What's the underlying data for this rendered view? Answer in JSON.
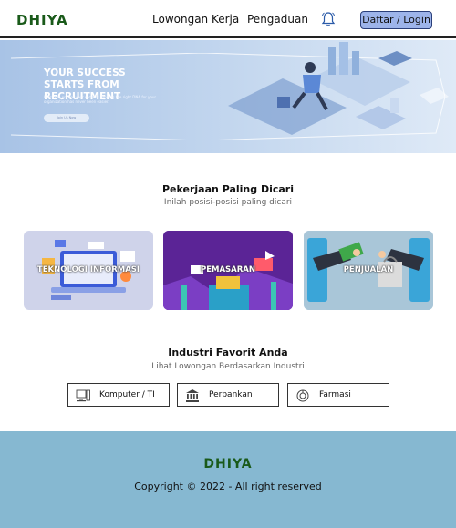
{
  "header": {
    "logo": "DHIYA",
    "nav": [
      "Lowongan Kerja",
      "Pengaduan"
    ],
    "login_label": "Daftar / Login",
    "bell_icon": "bell-icon"
  },
  "hero": {
    "title_line1": "YOUR SUCCESS",
    "title_line2": "STARTS FROM RECRUITMENT",
    "description": "Kerz.com ensure your success. Finding the right DNA for your organization has never been easier.",
    "button_label": "Join Us Now"
  },
  "jobs_section": {
    "title": "Pekerjaan Paling Dicari",
    "subtitle": "Inilah posisi-posisi paling dicari",
    "cards": [
      {
        "label": "TEKNOLOGI INFORMASI"
      },
      {
        "label": "PEMASARAN"
      },
      {
        "label": "PENJUALAN"
      }
    ]
  },
  "industry_section": {
    "title": "Industri Favorit Anda",
    "subtitle": "Lihat Lowongan Berdasarkan Industri",
    "items": [
      {
        "label": "Komputer / TI",
        "icon": "computer-icon"
      },
      {
        "label": "Perbankan",
        "icon": "bank-icon"
      },
      {
        "label": "Farmasi",
        "icon": "pharmacy-icon"
      }
    ]
  },
  "footer": {
    "logo": "DHIYA",
    "copyright": "Copyright © 2022 - All right reserved"
  },
  "colors": {
    "brand_green": "#1a5a1a",
    "login_button": "#9db4ea",
    "footer_bg": "#86b8d1",
    "hero_bg": "#a8c3e6"
  }
}
